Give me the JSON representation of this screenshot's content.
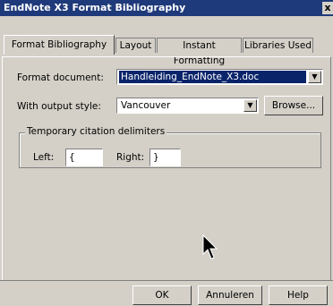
{
  "window": {
    "title": "EndNote X3 Format Bibliography",
    "close_label": "x"
  },
  "tabs": [
    {
      "label": "Format Bibliography"
    },
    {
      "label": "Layout"
    },
    {
      "label": "Instant Formatting"
    },
    {
      "label": "Libraries Used"
    }
  ],
  "form": {
    "format_document_label": "Format document:",
    "format_document_value": "Handleiding_EndNote_X3.doc",
    "output_style_label": "With output style:",
    "output_style_value": "Vancouver",
    "browse_label": "Browse..."
  },
  "delimiters": {
    "group_label": "Temporary citation delimiters",
    "left_label": "Left:",
    "left_value": "{",
    "right_label": "Right:",
    "right_value": "}"
  },
  "buttons": {
    "ok": "OK",
    "cancel": "Annuleren",
    "help": "Help"
  },
  "icons": {
    "dropdown": "chevron-down-icon",
    "cursor": "mouse-pointer-icon"
  }
}
